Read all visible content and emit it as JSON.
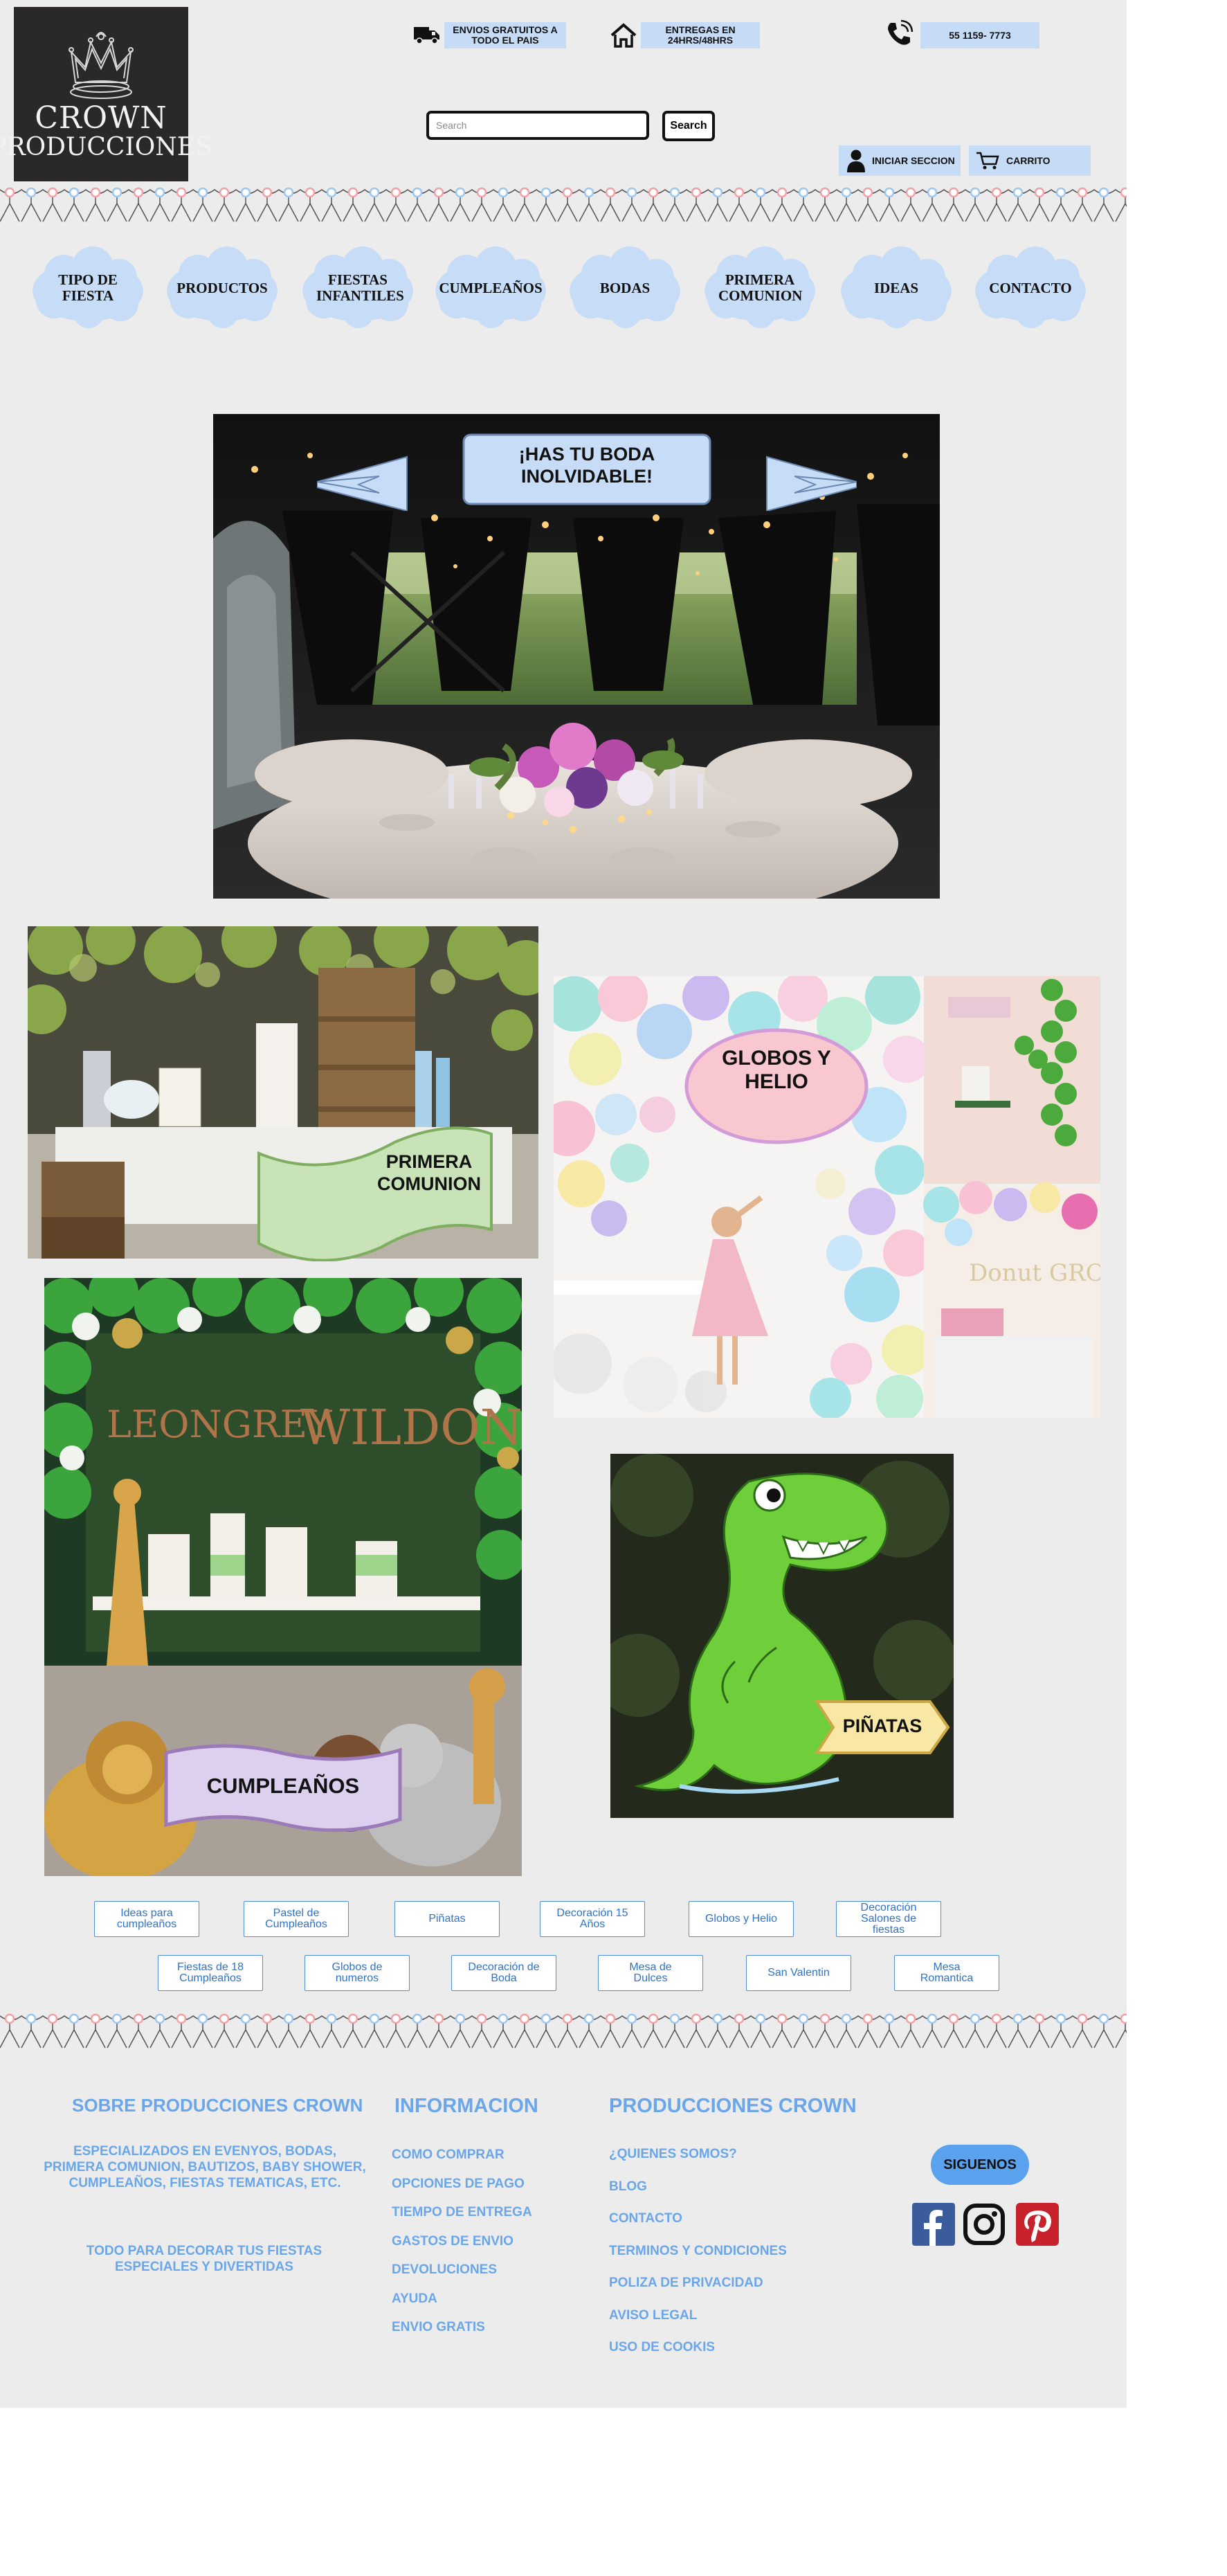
{
  "brand": {
    "line1": "CROWN",
    "line2": "PRODUCCIONES"
  },
  "header": {
    "shipping": "ENVIOS GRATUITOS A TODO EL PAIS",
    "delivery": "ENTREGAS EN 24HRS/48HRS",
    "phone": "55 1159- 7773",
    "search_placeholder": "Search",
    "search_button": "Search",
    "login": "INICIAR SECCION",
    "cart": "CARRITO"
  },
  "nav": [
    "TIPO DE FIESTA",
    "PRODUCTOS",
    "FIESTAS INFANTILES",
    "CUMPLEAÑOS",
    "BODAS",
    "PRIMERA COMUNION",
    "IDEAS",
    "CONTACTO"
  ],
  "hero": {
    "banner": "¡HAS TU BODA INOLVIDABLE!"
  },
  "tiles": {
    "comunion": "PRIMERA COMUNION",
    "globos": "GLOBOS Y HELIO",
    "cumple": "CUMPLEAÑOS",
    "pinatas": "PIÑATAS",
    "cumple_photo_text_1": "LEONGREY",
    "cumple_photo_text_2": "WILDONE",
    "globos_photo_text": "Donut GROW UP"
  },
  "categories_row1": [
    "Ideas para cumpleaños",
    "Pastel de Cumpleaños",
    "Piñatas",
    "Decoración 15 Años",
    "Globos y Helio",
    "Decoración Salones de fiestas"
  ],
  "categories_row2": [
    "Fiestas de 18 Cumpleaños",
    "Globos de numeros",
    "Decoración de Boda",
    "Mesa de Dulces",
    "San Valentin",
    "Mesa Romantica"
  ],
  "footer": {
    "about_title": "SOBRE PRODUCCIONES CROWN",
    "about_text": "ESPECIALIZADOS EN EVENYOS, BODAS, PRIMERA COMUNION, BAUTIZOS, BABY SHOWER, CUMPLEAÑOS, FIESTAS TEMATICAS, ETC.",
    "about_text2": "TODO PARA DECORAR TUS FIESTAS ESPECIALES Y DIVERTIDAS",
    "info_title": "INFORMACION",
    "info_links": [
      "COMO COMPRAR",
      "OPCIONES DE PAGO",
      "TIEMPO DE ENTREGA",
      "GASTOS DE ENVIO",
      "DEVOLUCIONES",
      "AYUDA",
      "ENVIO GRATIS"
    ],
    "crown_title": "PRODUCCIONES CROWN",
    "crown_links": [
      "¿QUIENES SOMOS?",
      "BLOG",
      "CONTACTO",
      "TERMINOS Y CONDICIONES",
      "POLIZA DE PRIVACIDAD",
      "AVISO LEGAL",
      "USO DE COOKIS"
    ],
    "follow": "SIGUENOS"
  },
  "colors": {
    "page_bg": "#ececec",
    "pill": "#c6dbf6",
    "footer_text": "#6aa6ea",
    "follow_bg": "#5aa2ee",
    "nav_cloud": "#c6dcf7"
  }
}
